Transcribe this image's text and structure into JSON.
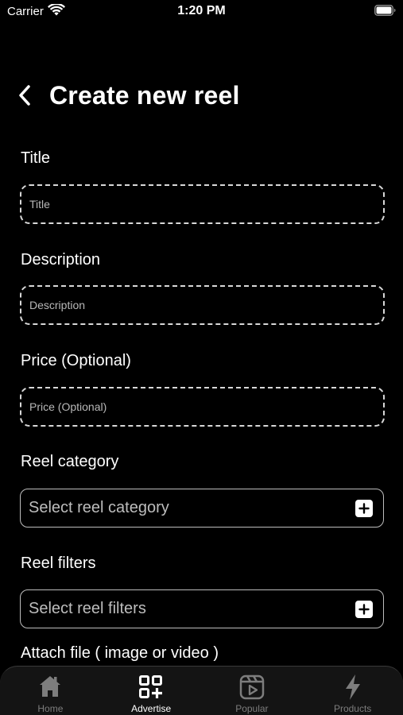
{
  "status": {
    "carrier": "Carrier",
    "time": "1:20 PM"
  },
  "header": {
    "title": "Create new reel"
  },
  "form": {
    "title": {
      "label": "Title",
      "placeholder": "Title",
      "value": ""
    },
    "description": {
      "label": "Description",
      "placeholder": "Description",
      "value": ""
    },
    "price": {
      "label": "Price (Optional)",
      "placeholder": "Price (Optional)",
      "value": ""
    },
    "category": {
      "label": "Reel category",
      "placeholder": "Select reel category"
    },
    "filters": {
      "label": "Reel filters",
      "placeholder": "Select reel filters"
    },
    "attach": {
      "label": "Attach file ( image or video )"
    }
  },
  "tabs": [
    {
      "label": "Home",
      "icon": "home-icon",
      "active": false
    },
    {
      "label": "Advertise",
      "icon": "grid-plus-icon",
      "active": true
    },
    {
      "label": "Popular",
      "icon": "reel-play-icon",
      "active": false
    },
    {
      "label": "Products",
      "icon": "lightning-icon",
      "active": false
    }
  ],
  "colors": {
    "background": "#000000",
    "accent": "#ffffff",
    "inactive": "#7d7d7d",
    "tabbar": "#141414"
  }
}
